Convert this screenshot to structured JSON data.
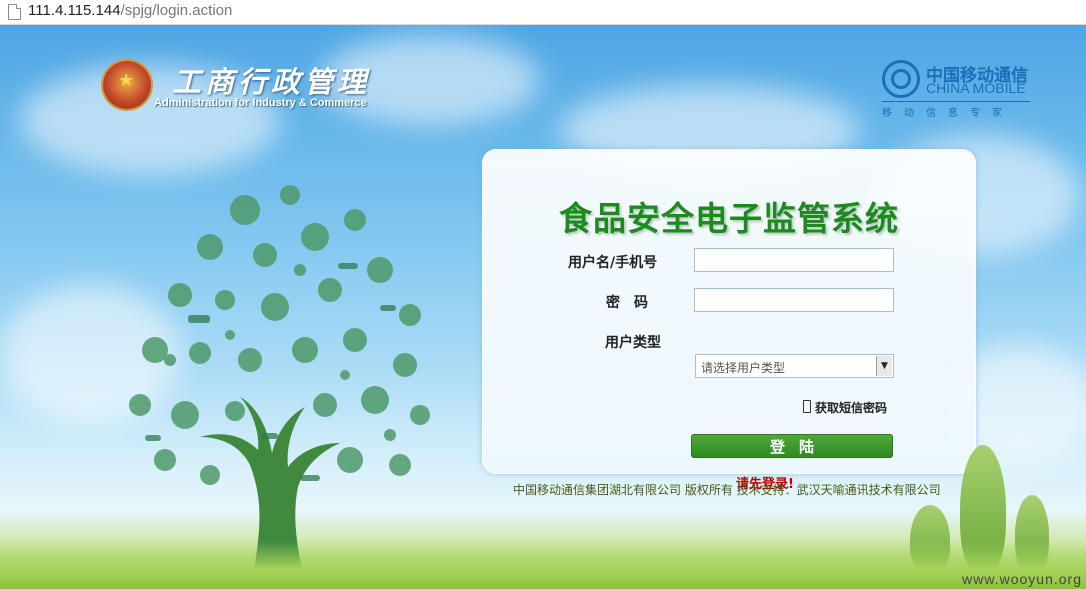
{
  "browser": {
    "url_host": "111.4.115.144",
    "url_path": "/spjg/login.action"
  },
  "header": {
    "logo_cn": "工商行政管理",
    "logo_en": "Administration for Industry & Commerce",
    "brand_cn": "中国移动通信",
    "brand_en": "CHINA MOBILE",
    "brand_tagline": "移动信息专家"
  },
  "login": {
    "title": "食品安全电子监管系统",
    "username_label": "用户名/手机号",
    "username_value": "",
    "password_label": "密　码",
    "password_value": "",
    "usertype_label": "用户类型",
    "usertype_selected": "请选择用户类型",
    "sms_link": "获取短信密码",
    "submit_label": "登陆",
    "message": "请先登录!"
  },
  "footer": {
    "copyright": "中国移动通信集团湖北有限公司 版权所有 技术支持：武汉天喻通讯技术有限公司"
  },
  "watermark": "www.wooyun.org",
  "colors": {
    "title_green": "#1e8a1e",
    "button_green": "#3a9a2c",
    "message_red": "#c00000",
    "brand_blue": "#1a6fb8"
  }
}
